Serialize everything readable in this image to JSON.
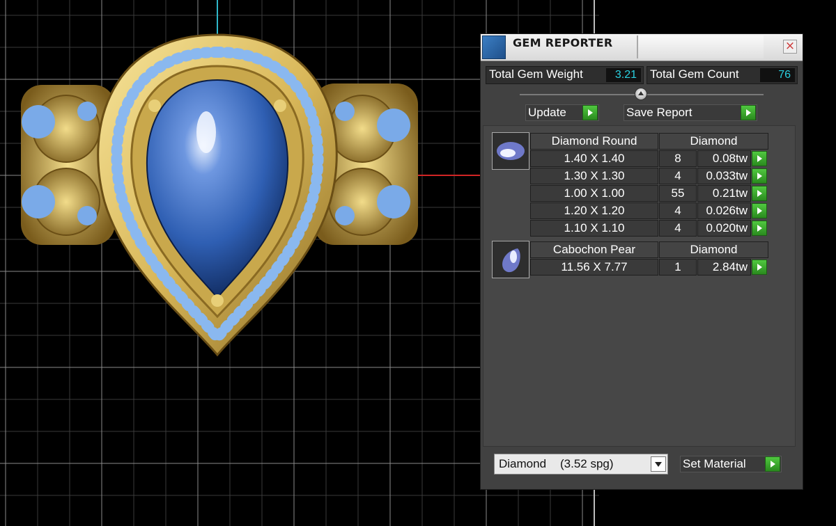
{
  "panel": {
    "title": "GEM REPORTER",
    "close_symbol": "×",
    "total_weight_label": "Total Gem Weight",
    "total_weight_value": "3.21",
    "total_count_label": "Total Gem Count",
    "total_count_value": "76",
    "update_label": "Update",
    "save_report_label": "Save Report",
    "groups": [
      {
        "shape": "Diamond Round",
        "material": "Diamond",
        "icon": "round-gem-icon",
        "rows": [
          {
            "size": "1.40 X 1.40",
            "count": "8",
            "weight": "0.08tw"
          },
          {
            "size": "1.30 X 1.30",
            "count": "4",
            "weight": "0.033tw"
          },
          {
            "size": "1.00 X 1.00",
            "count": "55",
            "weight": "0.21tw"
          },
          {
            "size": "1.20 X 1.20",
            "count": "4",
            "weight": "0.026tw"
          },
          {
            "size": "1.10 X 1.10",
            "count": "4",
            "weight": "0.020tw"
          }
        ]
      },
      {
        "shape": "Cabochon Pear",
        "material": "Diamond",
        "icon": "pear-gem-icon",
        "rows": [
          {
            "size": "11.56 X 7.77",
            "count": "1",
            "weight": "2.84tw"
          }
        ]
      }
    ],
    "material_select": {
      "name": "Diamond",
      "spg": "(3.52 spg)"
    },
    "set_material_label": "Set Material"
  },
  "colors": {
    "gold": "#d9b85a",
    "gem_blue": "#2f5fb3",
    "accent_cyan": "#2ad0e0",
    "go_green": "#3aa82b"
  }
}
